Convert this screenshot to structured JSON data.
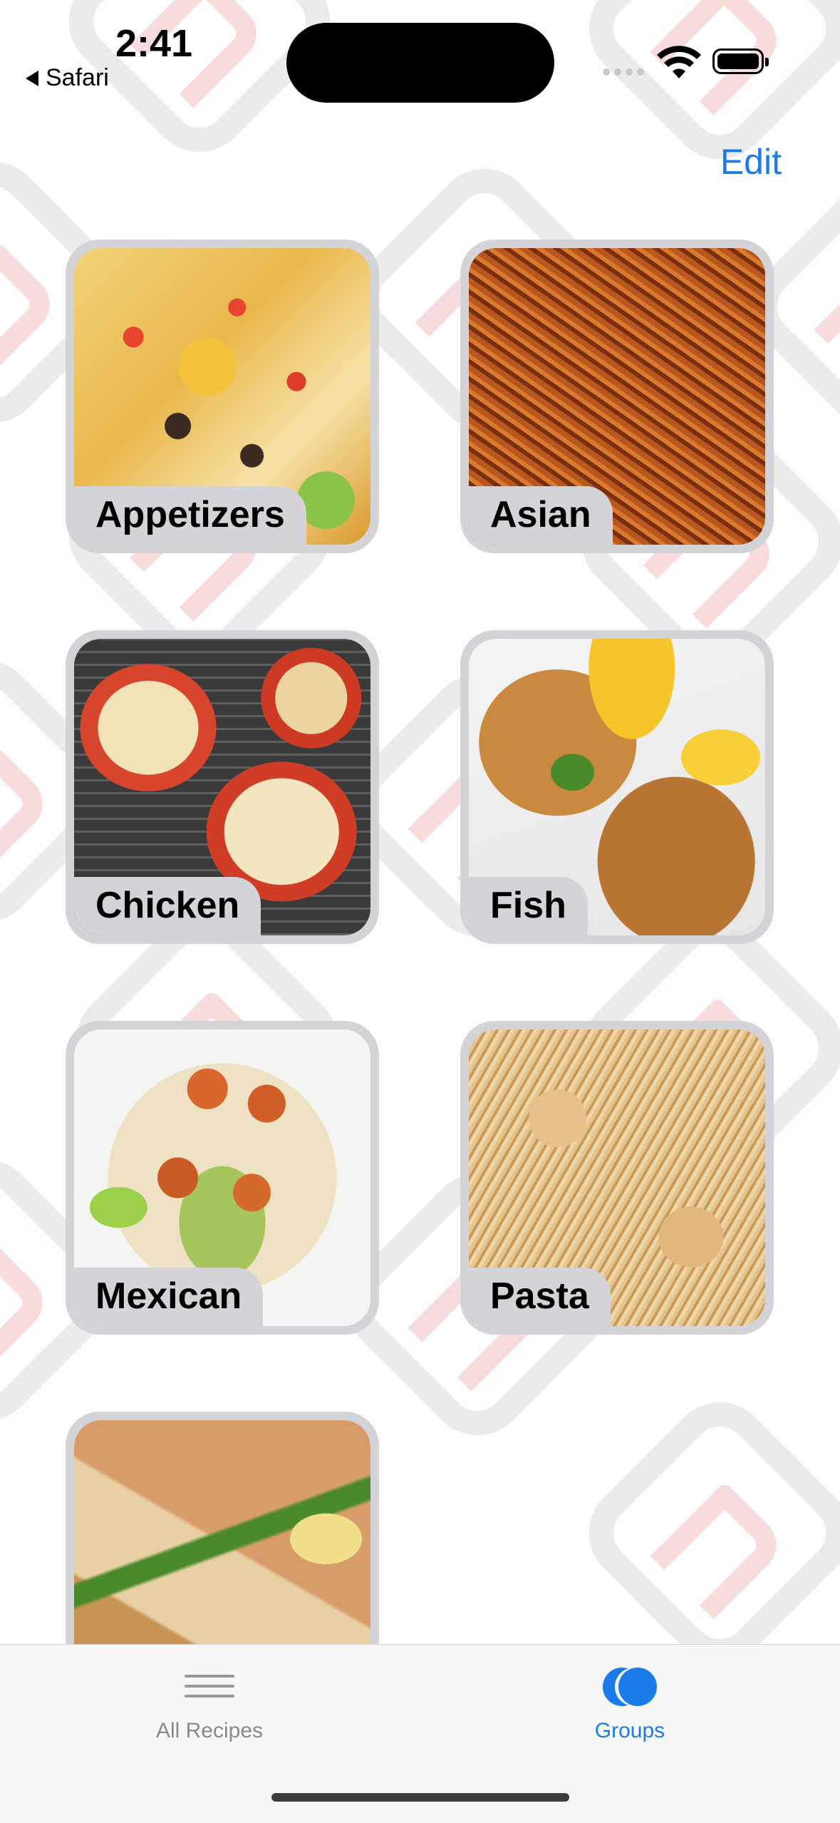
{
  "status_bar": {
    "time": "2:41",
    "back_app": "Safari"
  },
  "header": {
    "edit_label": "Edit"
  },
  "groups": [
    {
      "label": "Appetizers"
    },
    {
      "label": "Asian"
    },
    {
      "label": "Chicken"
    },
    {
      "label": "Fish"
    },
    {
      "label": "Mexican"
    },
    {
      "label": "Pasta"
    },
    {
      "label": ""
    }
  ],
  "tab_bar": {
    "tabs": [
      {
        "label": "All Recipes",
        "icon": "list-icon",
        "selected": false
      },
      {
        "label": "Groups",
        "icon": "groups-icon",
        "selected": true
      }
    ]
  },
  "colors": {
    "accent": "#1b7be8",
    "card_frame": "#d4d4d8",
    "inactive_tab": "#8a8a8e"
  }
}
